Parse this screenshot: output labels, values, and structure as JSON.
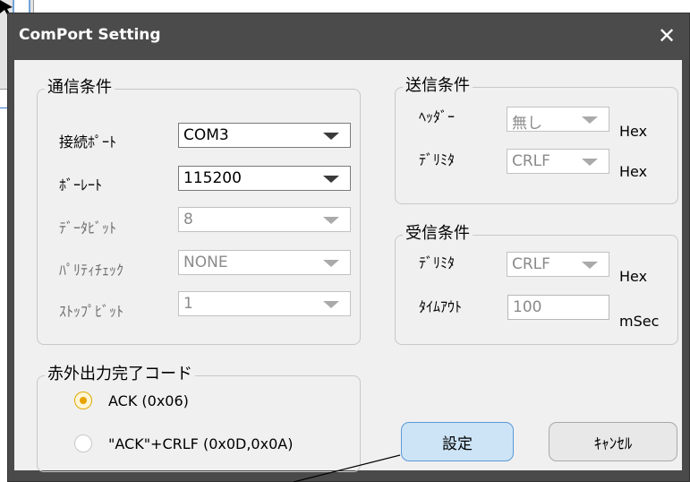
{
  "dialog": {
    "title": "ComPort Setting"
  },
  "comm": {
    "title": "通信条件",
    "fields": [
      {
        "label": "接続ﾎﾟｰﾄ",
        "value": "COM3"
      },
      {
        "label": "ﾎﾞｰﾚｰﾄ",
        "value": "115200"
      },
      {
        "label": "ﾃﾞｰﾀﾋﾞｯﾄ",
        "value": "8"
      },
      {
        "label": "ﾊﾟﾘﾃｨﾁｪｯｸ",
        "value": "NONE"
      },
      {
        "label": "ｽﾄｯﾌﾟﾋﾞｯﾄ",
        "value": "1"
      }
    ]
  },
  "send": {
    "title": "送信条件",
    "header_label": "ﾍｯﾀﾞｰ",
    "header_value": "無し",
    "delim_label": "ﾃﾞﾘﾐﾀ",
    "delim_value": "CRLF",
    "unit": "Hex"
  },
  "receive": {
    "title": "受信条件",
    "delim_label": "ﾃﾞﾘﾐﾀ",
    "delim_value": "CRLF",
    "delim_unit": "Hex",
    "timeout_label": "ﾀｲﾑｱｳﾄ",
    "timeout_value": "100",
    "timeout_unit": "mSec"
  },
  "ir": {
    "title": "赤外出力完了コード",
    "options": [
      {
        "label": "ACK (0x06)",
        "selected": true
      },
      {
        "label": "\"ACK\"+CRLF (0x0D,0x0A)",
        "selected": false
      }
    ]
  },
  "buttons": {
    "ok": "設定",
    "cancel": "ｷｬﾝｾﾙ"
  },
  "colors": {
    "titlebar": "#4b4b4b",
    "client": "#f0f0f0",
    "primary_button": "#cde4f7",
    "radio_selected": "#e8a300"
  }
}
